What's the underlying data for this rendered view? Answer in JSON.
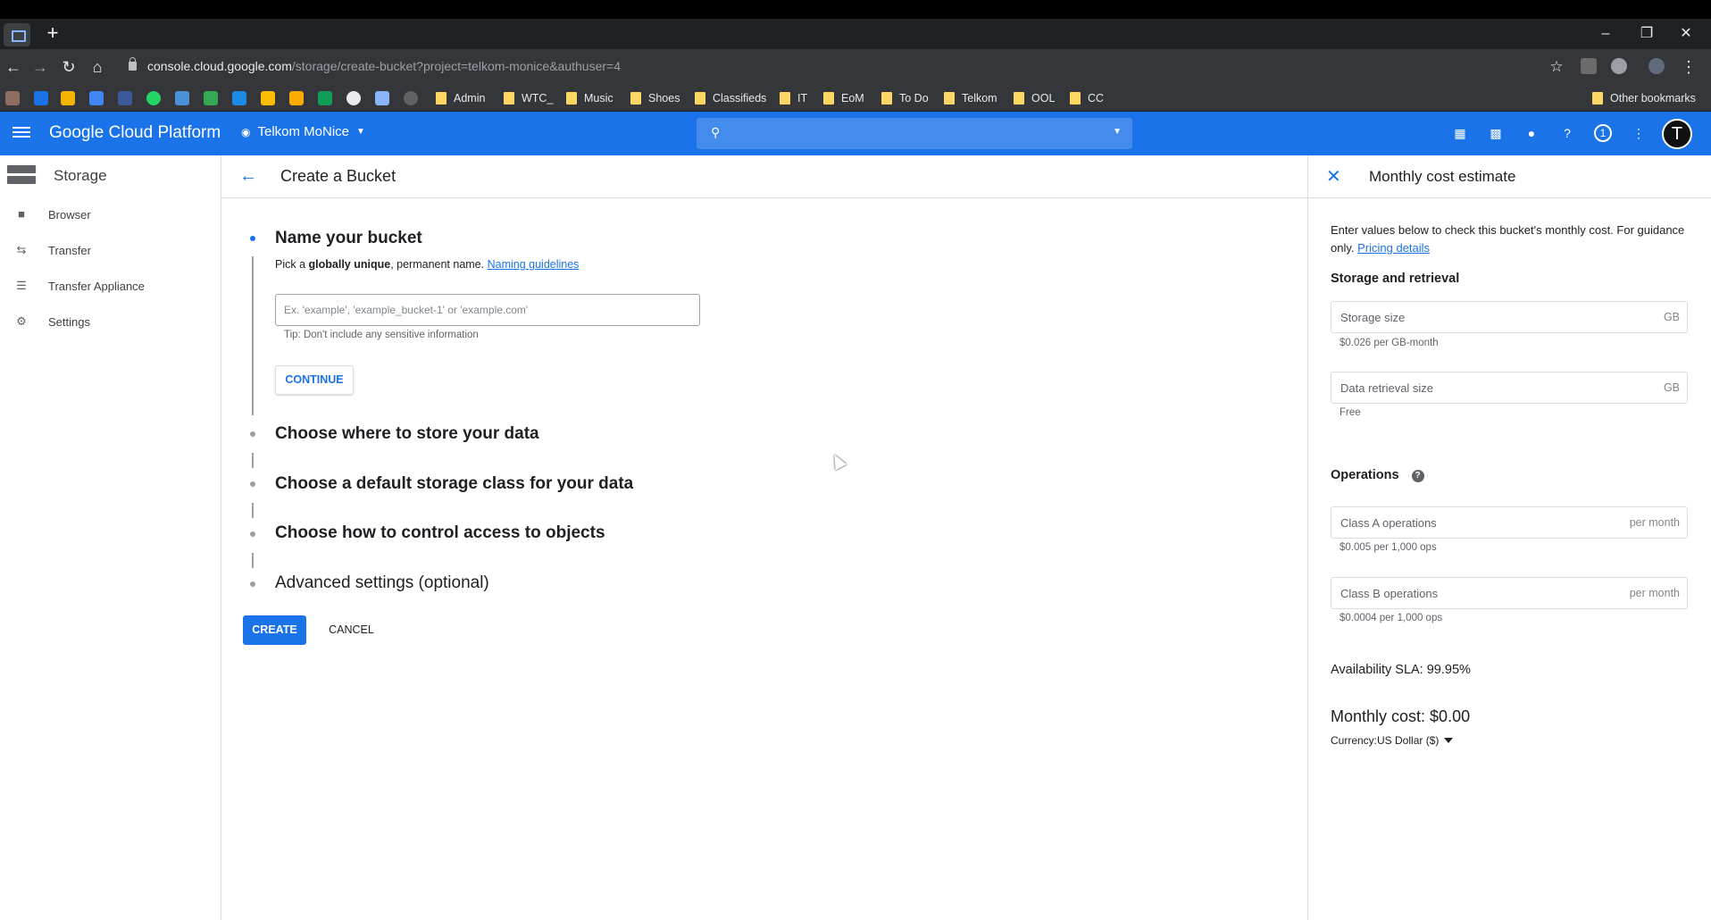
{
  "browser": {
    "url_host": "console.cloud.google.com",
    "url_path": "/storage/create-bucket?project=telkom-monice&authuser=4",
    "new_tab": "+",
    "bookmarks": [
      "Admin",
      "WTC_",
      "Music",
      "Shoes",
      "Classifieds",
      "IT",
      "EoM",
      "To Do",
      "Telkom",
      "OOL",
      "CC"
    ],
    "other_bookmarks": "Other bookmarks"
  },
  "header": {
    "product": "Google Cloud Platform",
    "project": "Telkom MoNice",
    "notifications_count": "1",
    "avatar_letter": "T"
  },
  "sidebar": {
    "title": "Storage",
    "items": [
      {
        "label": "Browser",
        "icon": "bucket-icon"
      },
      {
        "label": "Transfer",
        "icon": "transfer-icon"
      },
      {
        "label": "Transfer Appliance",
        "icon": "list-icon"
      },
      {
        "label": "Settings",
        "icon": "gear-icon"
      }
    ]
  },
  "main": {
    "title": "Create a Bucket",
    "steps": [
      {
        "title": "Name your bucket"
      },
      {
        "title": "Choose where to store your data"
      },
      {
        "title": "Choose a default storage class for your data"
      },
      {
        "title": "Choose how to control access to objects"
      },
      {
        "title": "Advanced settings (optional)"
      }
    ],
    "name_hint_pre": "Pick a ",
    "name_hint_bold": "globally unique",
    "name_hint_post": ", permanent name. ",
    "naming_link": "Naming guidelines",
    "name_placeholder": "Ex. 'example', 'example_bucket-1' or 'example.com'",
    "tip": "Tip: Don't include any sensitive information",
    "continue_label": "CONTINUE",
    "create_label": "CREATE",
    "cancel_label": "CANCEL"
  },
  "cost_panel": {
    "title": "Monthly cost estimate",
    "intro": "Enter values below to check this bucket's monthly cost. For guidance only. ",
    "pricing_link": "Pricing details",
    "storage_heading": "Storage and retrieval",
    "storage_size_label": "Storage size",
    "storage_size_unit": "GB",
    "storage_note": "$0.026 per GB-month",
    "retrieval_label": "Data retrieval size",
    "retrieval_unit": "GB",
    "retrieval_note": "Free",
    "operations_heading": "Operations",
    "class_a_label": "Class A operations",
    "class_a_unit": "per month",
    "class_a_note": "$0.005 per 1,000 ops",
    "class_b_label": "Class B operations",
    "class_b_unit": "per month",
    "class_b_note": "$0.0004 per 1,000 ops",
    "sla": "Availability SLA: 99.95%",
    "monthly_cost": "Monthly cost: $0.00",
    "currency_label": "Currency:",
    "currency_value": "US Dollar ($)"
  },
  "colors": {
    "brand_blue": "#1a73e8",
    "folder_yellow": "#fdd663"
  }
}
